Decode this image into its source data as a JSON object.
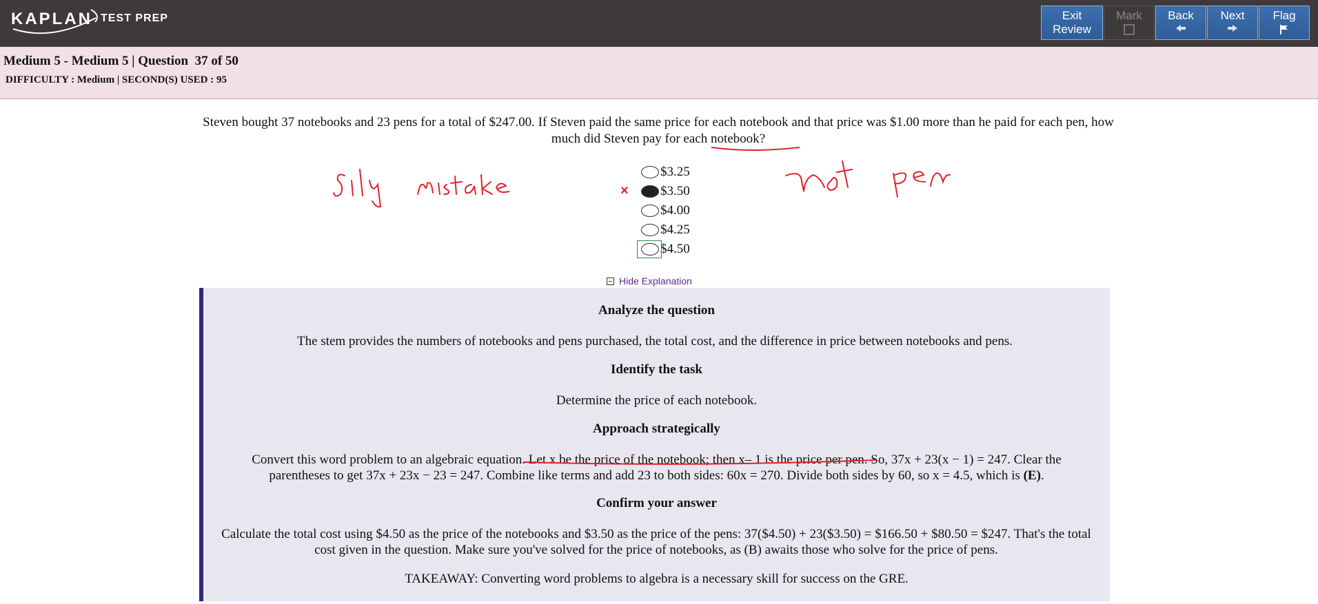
{
  "brand": {
    "name": "KAPLAN",
    "suffix": "TEST PREP"
  },
  "toolbar": {
    "exit_line1": "Exit",
    "exit_line2": "Review",
    "mark": "Mark",
    "back": "Back",
    "next": "Next",
    "flag": "Flag"
  },
  "header": {
    "title": "Medium 5 - Medium 5 | Question  37 of 50",
    "meta": "DIFFICULTY : Medium | SECOND(S) USED : 95"
  },
  "question": {
    "stem_part1": "Steven bought 37 notebooks and 23 pens for a total of $247.00. If Steven paid the same price for each notebook and that price was $1.00 more than he paid for each pen, how much did Steven pay for ",
    "stem_underlined": "each notebook",
    "stem_end": "?",
    "choices": [
      {
        "label": "$3.25",
        "selected": false
      },
      {
        "label": "$3.50",
        "selected": true,
        "marked_wrong": true
      },
      {
        "label": "$4.00",
        "selected": false
      },
      {
        "label": "$4.25",
        "selected": false
      },
      {
        "label": "$4.50",
        "selected": false,
        "focused": true
      }
    ],
    "wrong_mark": "×"
  },
  "explanation_toggle": "Hide Explanation",
  "explanation": {
    "h1": "Analyze the question",
    "p1": "The stem provides the numbers of notebooks and pens purchased, the total cost, and the difference in price between notebooks and pens.",
    "h2": "Identify the task",
    "p2": "Determine the price of each notebook.",
    "h3": "Approach strategically",
    "p3a": "Convert this word problem to an algebraic equation. ",
    "p3b": "Let x be the price of the notebook; then x– 1 is the price per pen",
    "p3c": ". So, 37x + 23(x − 1) = 247. Clear the parentheses to get 37x + 23x − 23 = 247. Combine like terms and add 23 to both sides: 60x = 270. Divide both sides by 60, so x = 4.5, which is ",
    "p3d": "(E)",
    "p3e": ".",
    "h4": "Confirm your answer",
    "p4": "Calculate the total cost using $4.50 as the price of the notebooks and $3.50 as the price of the pens: 37($4.50) + 23($3.50) = $166.50 + $80.50 = $247. That's the total cost given in the question. Make sure you've solved for the price of notebooks, as (B) awaits those who solve for the price of pens.",
    "p5": "TAKEAWAY: Converting word problems to algebra is a necessary skill for success on the GRE."
  },
  "handwriting": {
    "note_left": "Silly mistake",
    "note_right": "not pen"
  },
  "colors": {
    "topbar": "#3d3a39",
    "button": "#3c6fae",
    "band": "#f1e0e4",
    "explain_bg": "#e8e7ef",
    "ink": "#e0222a"
  }
}
